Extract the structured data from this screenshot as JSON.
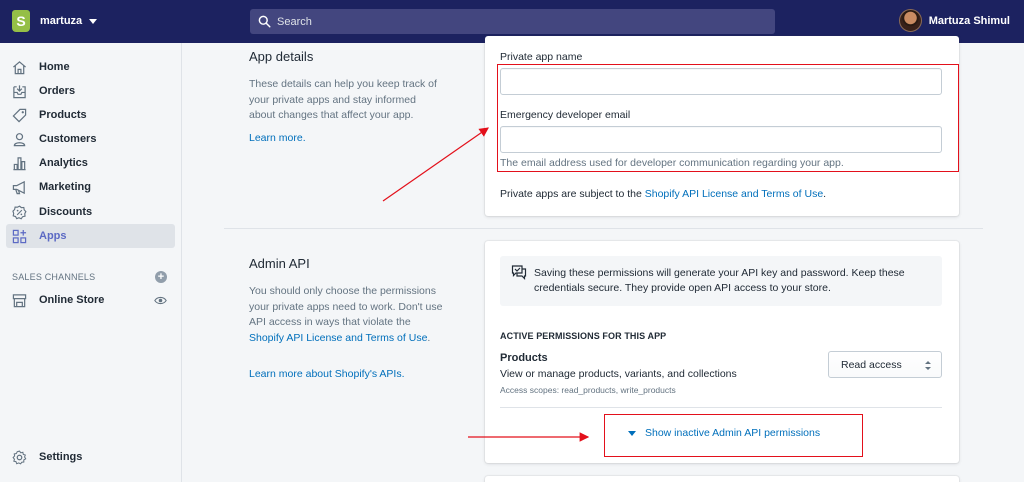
{
  "topbar": {
    "store_name": "martuza",
    "store_logo_glyph": "S",
    "search_placeholder": "Search",
    "user_name": "Martuza Shimul"
  },
  "sidebar": {
    "items": [
      {
        "label": "Home",
        "icon": "home-icon"
      },
      {
        "label": "Orders",
        "icon": "orders-icon"
      },
      {
        "label": "Products",
        "icon": "tag-icon"
      },
      {
        "label": "Customers",
        "icon": "person-icon"
      },
      {
        "label": "Analytics",
        "icon": "bar-chart-icon"
      },
      {
        "label": "Marketing",
        "icon": "megaphone-icon"
      },
      {
        "label": "Discounts",
        "icon": "discount-icon"
      },
      {
        "label": "Apps",
        "icon": "apps-icon",
        "active": true
      }
    ],
    "sales_channels_label": "SALES CHANNELS",
    "channels": [
      {
        "label": "Online Store",
        "icon": "store-icon"
      }
    ],
    "settings_label": "Settings"
  },
  "app_details": {
    "title": "App details",
    "description": "These details can help you keep track of your private apps and stay informed about changes that affect your app.",
    "learn_more": "Learn more.",
    "app_name_label": "Private app name",
    "app_name_value": "",
    "email_label": "Emergency developer email",
    "email_value": "",
    "email_help": "The email address used for developer communication regarding your app.",
    "terms_prefix": "Private apps are subject to the ",
    "terms_link": "Shopify API License and Terms of Use",
    "terms_suffix": "."
  },
  "admin_api": {
    "title": "Admin API",
    "description": "You should only choose the permissions your private apps need to work. Don't use API access in ways that violate the ",
    "description_link": "Shopify API License and Terms of Use",
    "description_suffix": ".",
    "learn_more": "Learn more about Shopify's APIs.",
    "banner_text": "Saving these permissions will generate your API key and password. Keep these credentials secure. They provide open API access to your store.",
    "active_heading": "ACTIVE PERMISSIONS FOR THIS APP",
    "permission": {
      "title": "Products",
      "description": "View or manage products, variants, and collections",
      "scopes": "Access scopes: read_products, write_products",
      "access_value": "Read access"
    },
    "show_inactive": "Show inactive Admin API permissions"
  },
  "annotations": {
    "color": "#e3101b"
  },
  "colors": {
    "topbar": "#1c2260",
    "link": "#006fbb",
    "active_nav": "#5c6ac4",
    "logo": "#95bf47"
  }
}
